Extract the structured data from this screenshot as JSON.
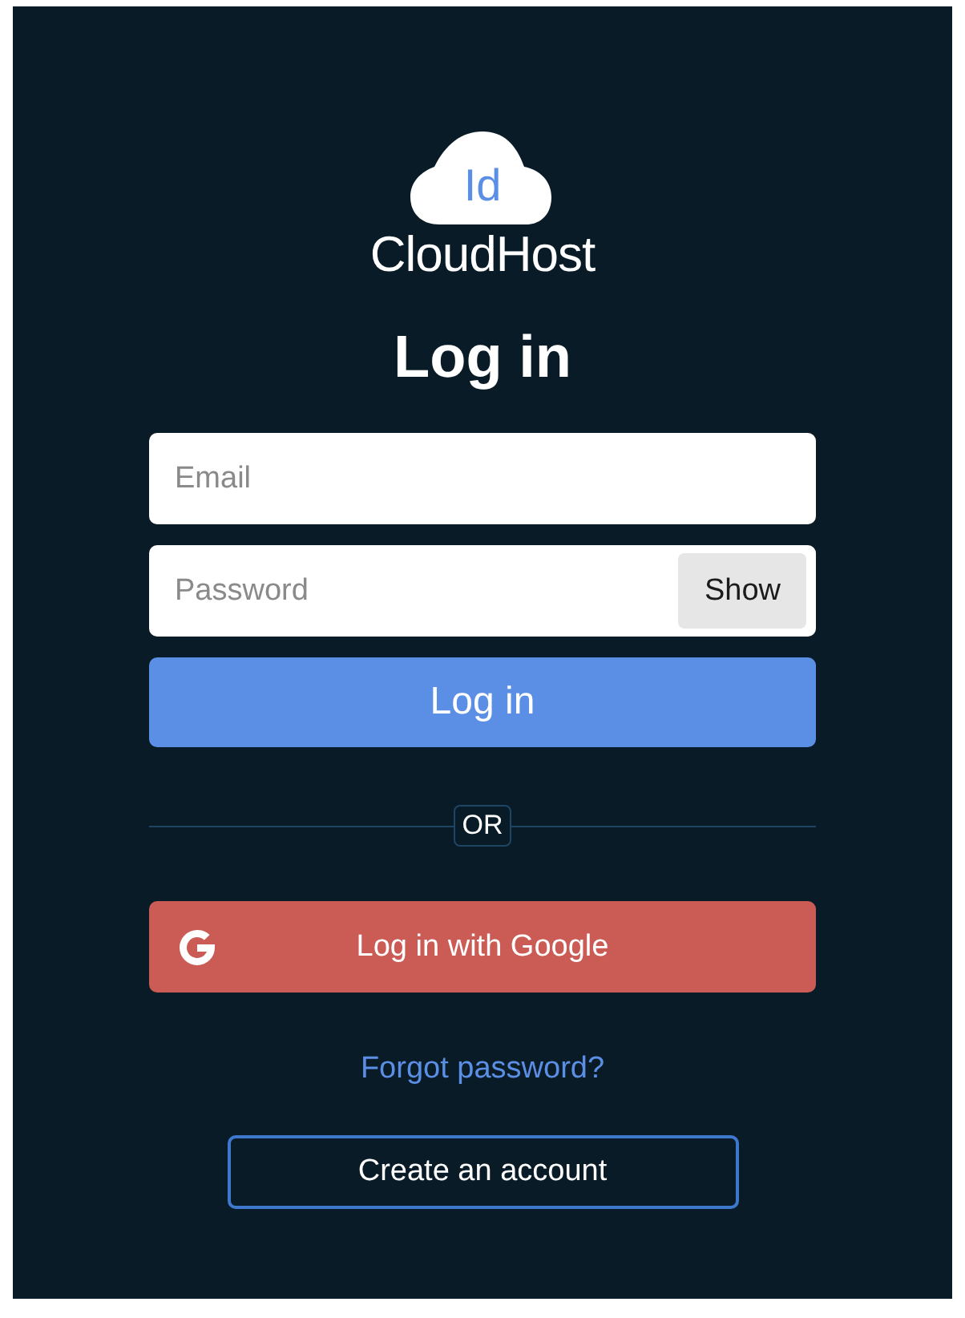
{
  "logo": {
    "mark": "Id",
    "name": "CloudHost"
  },
  "heading": "Log in",
  "email": {
    "placeholder": "Email"
  },
  "password": {
    "placeholder": "Password",
    "toggle": "Show"
  },
  "submit": "Log in",
  "divider": "OR",
  "google_button": "Log in with Google",
  "forgot_link": "Forgot password?",
  "create_account": "Create an account"
}
